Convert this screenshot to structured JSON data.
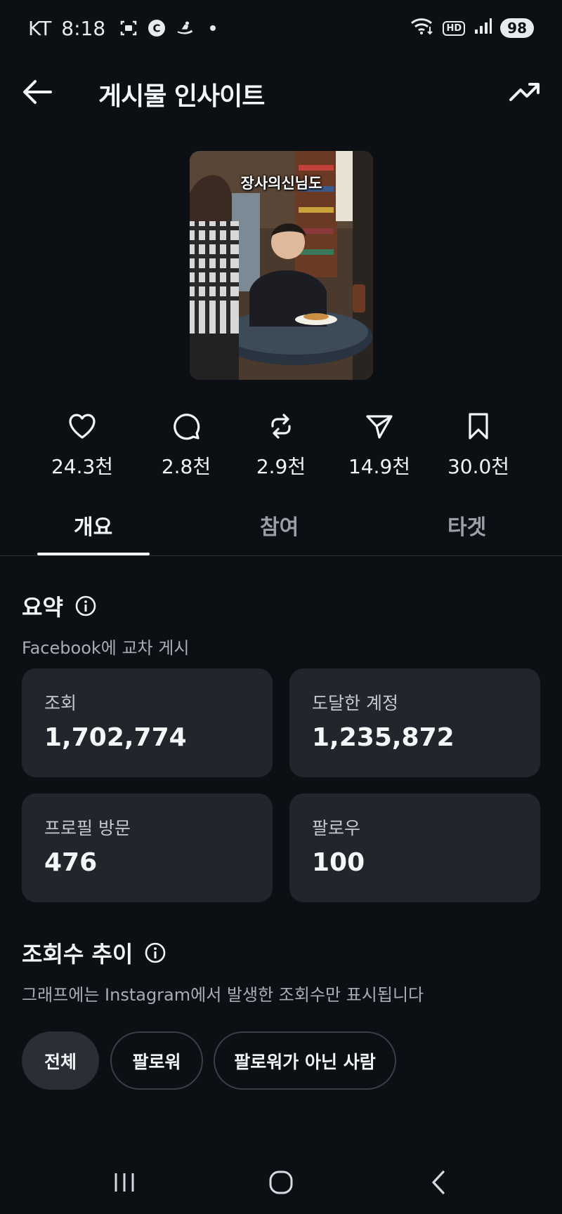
{
  "status_bar": {
    "carrier": "KT",
    "time": "8:18",
    "hd": "HD",
    "battery": "98",
    "icons": [
      "screenshot-icon",
      "c-icon",
      "ski-icon",
      "dot-icon",
      "wifi-icon",
      "signal-icon"
    ]
  },
  "header": {
    "title": "게시물 인사이트"
  },
  "thumbnail": {
    "caption": "장사의신님도"
  },
  "stats": [
    {
      "icon": "heart-icon",
      "value": "24.3천"
    },
    {
      "icon": "comment-icon",
      "value": "2.8천"
    },
    {
      "icon": "repost-icon",
      "value": "2.9천"
    },
    {
      "icon": "share-icon",
      "value": "14.9천"
    },
    {
      "icon": "bookmark-icon",
      "value": "30.0천"
    }
  ],
  "tabs": [
    {
      "label": "개요",
      "active": true
    },
    {
      "label": "참여",
      "active": false
    },
    {
      "label": "타겟",
      "active": false
    }
  ],
  "summary": {
    "title": "요약",
    "subtitle": "Facebook에 교차 게시",
    "cards": [
      {
        "label": "조회",
        "value": "1,702,774"
      },
      {
        "label": "도달한 계정",
        "value": "1,235,872"
      },
      {
        "label": "프로필 방문",
        "value": "476"
      },
      {
        "label": "팔로우",
        "value": "100"
      }
    ]
  },
  "views_trend": {
    "title": "조회수 추이",
    "subtitle": "그래프에는 Instagram에서 발생한 조회수만 표시됩니다",
    "filters": [
      {
        "label": "전체",
        "active": true
      },
      {
        "label": "팔로워",
        "active": false
      },
      {
        "label": "팔로워가 아닌 사람",
        "active": false
      }
    ]
  },
  "colors": {
    "background": "#0c0f14",
    "card": "#21252c",
    "text": "#f2f4f7",
    "muted": "#a8adb5"
  }
}
